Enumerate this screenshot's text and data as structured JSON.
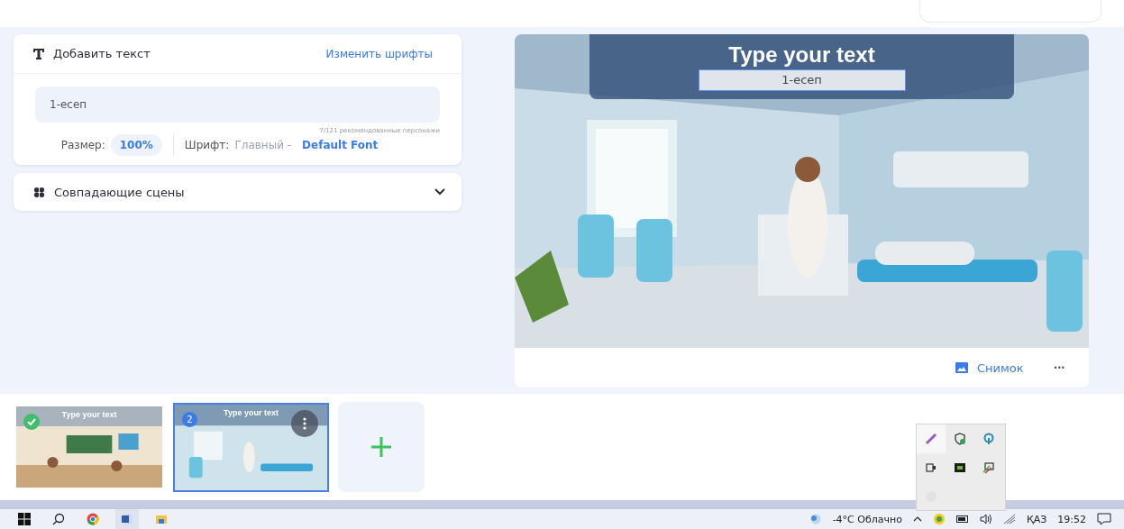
{
  "text_panel": {
    "title": "Добавить текст",
    "change_fonts_link": "Изменить шрифты",
    "text_field": {
      "value": "1-есеп"
    },
    "counter": "7/121 рекомендованные персонажи",
    "size_label": "Размер:",
    "size_value": "100%",
    "font_label": "Шрифт:",
    "font_group": "Главный -",
    "font_name": "Default Font"
  },
  "matching_scenes": {
    "title": "Совпадающие сцены",
    "expanded": false
  },
  "preview": {
    "overlay_text": "Type your text",
    "selected_text": "1-есеп",
    "snapshot_button": "Снимок",
    "more_button": "•••"
  },
  "scenes": [
    {
      "caption": "Type your text",
      "selected": false,
      "done": true
    },
    {
      "caption": "Type your text",
      "selected": true,
      "done": false,
      "number": "2"
    }
  ],
  "taskbar": {
    "weather": "-4°C Облачно",
    "language": "ҚАЗ",
    "time": "19:52"
  }
}
